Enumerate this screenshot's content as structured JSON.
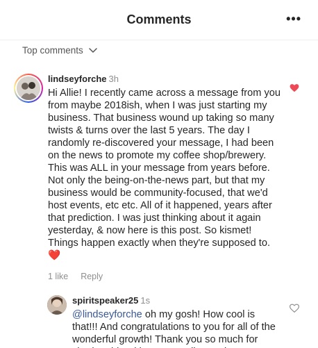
{
  "header": {
    "title": "Comments",
    "more_icon": "more-horizontal-icon"
  },
  "filter": {
    "label": "Top comments",
    "icon": "chevron-down-icon"
  },
  "comment": {
    "username": "lindseyforche",
    "time": "3h",
    "text": "Hi Allie! I recently came across a message from you from maybe 2018ish, when I was just starting my business. That business wound up taking so many twists & turns over the last 5 years. The day I randomly re-discovered your message, I had been on the news to promote my coffee shop/brewery. This was ALL in your message from years before. Not only the being-on-the-news part, but that my business would be community-focused, that we'd host events, etc etc. All of it happened, years after that prediction. I was just thinking about it again yesterday, & now here is this post. So kismet! Things happen exactly when they're supposed to.",
    "emoji": "❤️",
    "likes": "1 like",
    "reply_label": "Reply",
    "liked": true,
    "like_color": "#ed4956"
  },
  "reply": {
    "username": "spiritspeaker25",
    "time": "1s",
    "mention": "@lindseyforche",
    "text": " oh my gosh! How cool is that!!! And congratulations to you for all of the wonderful growth! Thank you so much for sharing this with me as well. You don't",
    "liked": false
  }
}
